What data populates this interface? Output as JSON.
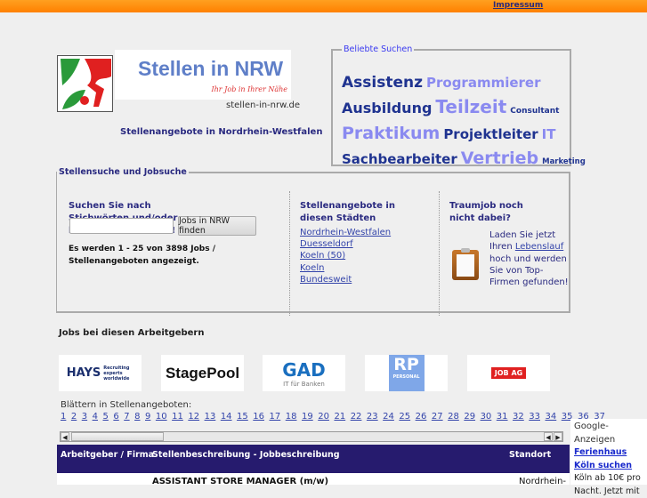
{
  "header": {
    "impressum": "Impressum"
  },
  "brand": {
    "title": "Stellen in NRW",
    "slogan": "Ihr Job in Ihrer Nähe",
    "domain": "stellen-in-nrw.de",
    "subtitle": "Stellenangebote in Nordrhein-Westfalen"
  },
  "popular": {
    "legend": "Beliebte Suchen",
    "tags": [
      {
        "label": "Assistenz",
        "style": "dk",
        "size": 17
      },
      {
        "label": "Programmierer",
        "style": "lt",
        "size": 15
      },
      {
        "label": "Ausbildung",
        "style": "dk",
        "size": 16
      },
      {
        "label": "Teilzeit",
        "style": "lt",
        "size": 20
      },
      {
        "label": "Consultant",
        "style": "dk",
        "size": 9
      },
      {
        "label": "Praktikum",
        "style": "lt",
        "size": 19
      },
      {
        "label": "Projektleiter",
        "style": "dk",
        "size": 15
      },
      {
        "label": "IT",
        "style": "lt",
        "size": 15
      },
      {
        "label": "Sachbearbeiter",
        "style": "dk",
        "size": 15
      },
      {
        "label": "Vertrieb",
        "style": "lt",
        "size": 19
      },
      {
        "label": "Marketing",
        "style": "dk",
        "size": 8.5
      }
    ]
  },
  "search": {
    "legend": "Stellensuche und Jobsuche",
    "prompt": "Suchen Sie nach Stichwörten und/oder bestimmten Städten!",
    "query": "",
    "button": "Jobs in NRW finden",
    "count_text": "Es werden 1 - 25 von 3898 Jobs / Stellenangeboten angezeigt.",
    "cities_title": "Stellenangebote in diesen Städten",
    "cities": [
      "Nordrhein-Westfalen",
      "Duesseldorf",
      "Koeln (50)",
      "Koeln",
      "Bundesweit"
    ],
    "dream_title": "Traumjob noch nicht dabei?",
    "dream_pre": "Laden Sie jetzt Ihren ",
    "dream_link": "Lebenslauf",
    "dream_post": " hoch und werden Sie von Top-Firmen gefunden!"
  },
  "employers": {
    "title": "Jobs bei diesen Arbeitgebern",
    "logos": [
      "HAYS",
      "StagePool",
      "GAD",
      "RP",
      "JOB AG"
    ],
    "hays_tag": "Recruiting experts worldwide",
    "gad_tag": "IT für Banken",
    "rp_tag": "PERSONAL"
  },
  "pager": {
    "label": "Blättern in Stellenangeboten:",
    "pages": [
      "1",
      "2",
      "3",
      "4",
      "5",
      "6",
      "7",
      "8",
      "9",
      "10",
      "11",
      "12",
      "13",
      "14",
      "15",
      "16",
      "17",
      "18",
      "19",
      "20",
      "21",
      "22",
      "23",
      "24",
      "25",
      "26",
      "27",
      "28",
      "29",
      "30",
      "31",
      "32",
      "33",
      "34",
      "35",
      "36",
      "37"
    ]
  },
  "table": {
    "headers": [
      "Arbeitgeber / Firma",
      "Stellenbeschreibung - Jobbeschreibung",
      "Standort"
    ],
    "rows": [
      {
        "employer": "",
        "title": "ASSISTANT STORE MANAGER (m/w)",
        "location": "Nordrhein-"
      }
    ]
  },
  "ad": {
    "label": "Google-Anzeigen",
    "link": "Ferienhaus Köln suchen",
    "text": "Köln ab 10€ pro Nacht. Jetzt mit"
  }
}
